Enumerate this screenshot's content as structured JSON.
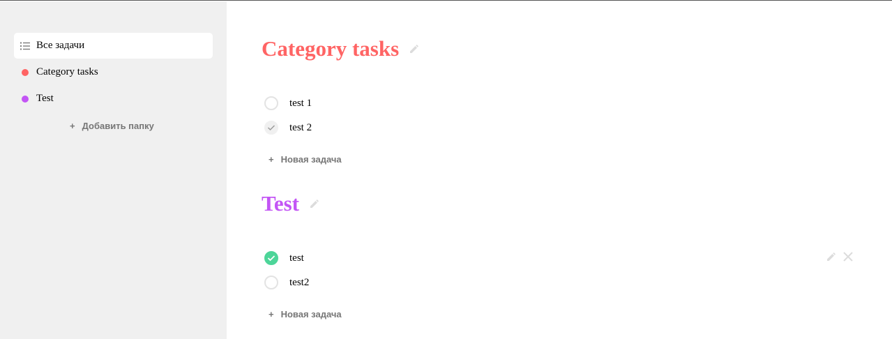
{
  "sidebar": {
    "items": [
      {
        "label": "Все задачи",
        "icon": "list-icon"
      },
      {
        "label": "Category tasks",
        "color": "#ff6464"
      },
      {
        "label": "Test",
        "color": "#c355f5"
      }
    ],
    "add_folder_label": "Добавить папку"
  },
  "categories": [
    {
      "title": "Category tasks",
      "color": "#ff6464",
      "tasks": [
        {
          "text": "test 1",
          "state": "unchecked"
        },
        {
          "text": "test 2",
          "state": "checked-gray"
        }
      ],
      "add_task_label": "Новая задача"
    },
    {
      "title": "Test",
      "color": "#c355f5",
      "tasks": [
        {
          "text": "test",
          "state": "checked-green"
        },
        {
          "text": "test2",
          "state": "unchecked"
        }
      ],
      "add_task_label": "Новая задача"
    }
  ],
  "colors": {
    "sidebar_bg": "#f0f0f0",
    "done_green": "#4dd599",
    "muted": "#767676"
  }
}
